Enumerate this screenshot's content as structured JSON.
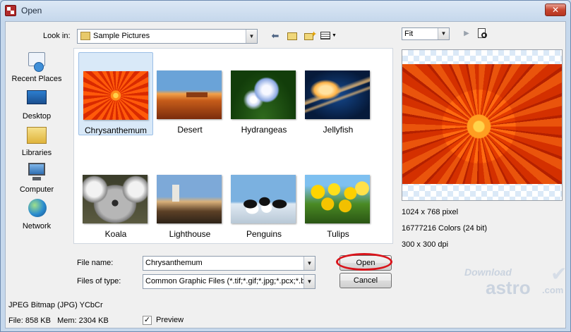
{
  "window": {
    "title": "Open"
  },
  "lookin": {
    "label": "Look in:",
    "value": "Sample Pictures"
  },
  "places": [
    {
      "label": "Recent Places",
      "icon": "recent-places-icon"
    },
    {
      "label": "Desktop",
      "icon": "desktop-icon"
    },
    {
      "label": "Libraries",
      "icon": "libraries-icon"
    },
    {
      "label": "Computer",
      "icon": "computer-icon"
    },
    {
      "label": "Network",
      "icon": "network-icon"
    }
  ],
  "files": [
    {
      "name": "Chrysanthemum",
      "selected": true
    },
    {
      "name": "Desert"
    },
    {
      "name": "Hydrangeas"
    },
    {
      "name": "Jellyfish"
    },
    {
      "name": "Koala"
    },
    {
      "name": "Lighthouse"
    },
    {
      "name": "Penguins"
    },
    {
      "name": "Tulips"
    }
  ],
  "filename": {
    "label": "File name:",
    "value": "Chrysanthemum"
  },
  "filetype": {
    "label": "Files of type:",
    "value": "Common Graphic Files (*.tif;*.gif;*.jpg;*.pcx;*.bm"
  },
  "buttons": {
    "open": "Open",
    "cancel": "Cancel"
  },
  "preview": {
    "zoom": "Fit",
    "dimensions": "1024 x 768 pixel",
    "colors": "16777216 Colors (24 bit)",
    "dpi": "300 x 300 dpi"
  },
  "status": {
    "format": "JPEG Bitmap (JPG) YCbCr",
    "sizes": "File: 858 KB   Mem: 2304 KB",
    "preview_label": "Preview",
    "preview_checked": true
  },
  "watermark": {
    "line1": "Download",
    "line2": "astro",
    "line3": ".com"
  },
  "colors": {
    "accent_ring": "#d9141b",
    "selection": "#d9e9f8"
  }
}
